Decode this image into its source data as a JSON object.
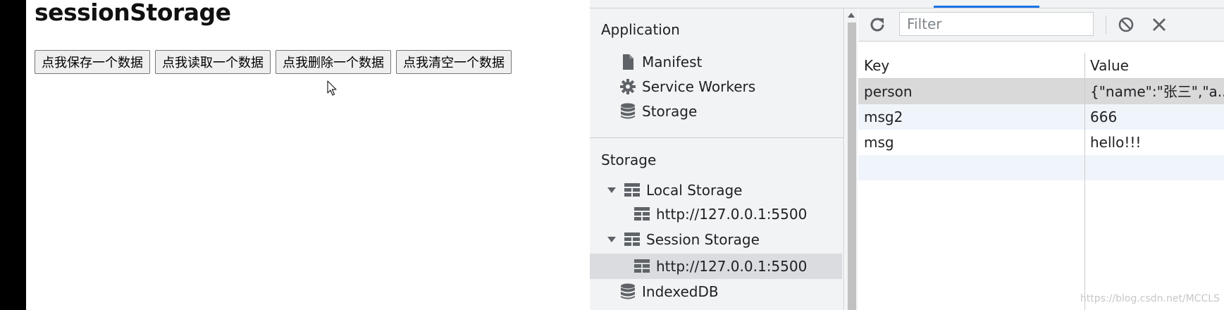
{
  "page": {
    "title": "sessionStorage",
    "buttons": [
      "点我保存一个数据",
      "点我读取一个数据",
      "点我删除一个数据",
      "点我清空一个数据"
    ]
  },
  "devtools": {
    "sidebar": {
      "application_heading": "Application",
      "application_items": [
        {
          "label": "Manifest",
          "icon": "file-icon"
        },
        {
          "label": "Service Workers",
          "icon": "gear-icon"
        },
        {
          "label": "Storage",
          "icon": "database-icon"
        }
      ],
      "storage_heading": "Storage",
      "local_storage": {
        "label": "Local Storage",
        "origin": "http://127.0.0.1:5500"
      },
      "session_storage": {
        "label": "Session Storage",
        "origin": "http://127.0.0.1:5500",
        "selected": true
      },
      "indexeddb": {
        "label": "IndexedDB"
      }
    },
    "toolbar": {
      "filter_placeholder": "Filter",
      "icons": [
        "refresh-icon",
        "block-icon",
        "clear-icon"
      ]
    },
    "table": {
      "columns": [
        "Key",
        "Value"
      ],
      "rows": [
        {
          "key": "person",
          "value": "{\"name\":\"张三\",\"a..."
        },
        {
          "key": "msg2",
          "value": "666"
        },
        {
          "key": "msg",
          "value": "hello!!!"
        }
      ]
    }
  },
  "watermark": "https://blog.csdn.net/MCCLS",
  "colors": {
    "accent": "#1a73e8",
    "sidebar_bg": "#f1f3f4",
    "selected_row": "#d9d9d9",
    "striped_row": "#f0f4fb"
  }
}
